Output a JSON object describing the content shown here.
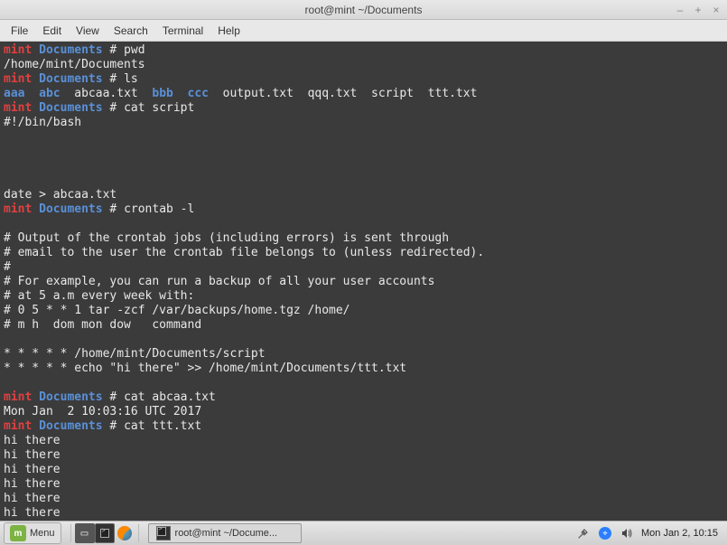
{
  "window": {
    "title": "root@mint ~/Documents",
    "controls": {
      "min": "–",
      "max": "+",
      "close": "×"
    }
  },
  "menubar": [
    "File",
    "Edit",
    "View",
    "Search",
    "Terminal",
    "Help"
  ],
  "terminal": {
    "user": "mint",
    "cwd": "Documents",
    "promptChar": " # ",
    "lines": [
      {
        "type": "prompt",
        "cmd": "pwd"
      },
      {
        "type": "out",
        "text": "/home/mint/Documents"
      },
      {
        "type": "prompt",
        "cmd": "ls"
      },
      {
        "type": "ls",
        "blue": [
          "aaa",
          "abc"
        ],
        "norm1": "abcaa.txt",
        "blue2": [
          "bbb",
          "ccc"
        ],
        "rest": "output.txt  qqq.txt  script  ttt.txt"
      },
      {
        "type": "prompt",
        "cmd": "cat script"
      },
      {
        "type": "out",
        "text": "#!/bin/bash"
      },
      {
        "type": "blank"
      },
      {
        "type": "blank"
      },
      {
        "type": "blank"
      },
      {
        "type": "blank"
      },
      {
        "type": "out",
        "text": "date > abcaa.txt"
      },
      {
        "type": "prompt",
        "cmd": "crontab -l"
      },
      {
        "type": "blank"
      },
      {
        "type": "out",
        "text": "# Output of the crontab jobs (including errors) is sent through"
      },
      {
        "type": "out",
        "text": "# email to the user the crontab file belongs to (unless redirected)."
      },
      {
        "type": "out",
        "text": "#"
      },
      {
        "type": "out",
        "text": "# For example, you can run a backup of all your user accounts"
      },
      {
        "type": "out",
        "text": "# at 5 a.m every week with:"
      },
      {
        "type": "out",
        "text": "# 0 5 * * 1 tar -zcf /var/backups/home.tgz /home/"
      },
      {
        "type": "out",
        "text": "# m h  dom mon dow   command"
      },
      {
        "type": "blank"
      },
      {
        "type": "out",
        "text": "* * * * * /home/mint/Documents/script"
      },
      {
        "type": "out",
        "text": "* * * * * echo \"hi there\" >> /home/mint/Documents/ttt.txt"
      },
      {
        "type": "blank"
      },
      {
        "type": "prompt",
        "cmd": "cat abcaa.txt"
      },
      {
        "type": "out",
        "text": "Mon Jan  2 10:03:16 UTC 2017"
      },
      {
        "type": "prompt",
        "cmd": "cat ttt.txt"
      },
      {
        "type": "out",
        "text": "hi there"
      },
      {
        "type": "out",
        "text": "hi there"
      },
      {
        "type": "out",
        "text": "hi there"
      },
      {
        "type": "out",
        "text": "hi there"
      },
      {
        "type": "out",
        "text": "hi there"
      },
      {
        "type": "out",
        "text": "hi there"
      }
    ]
  },
  "taskbar": {
    "menuLabel": "Menu",
    "activeTask": "root@mint ~/Docume...",
    "clock": "Mon Jan  2, 10:15"
  }
}
